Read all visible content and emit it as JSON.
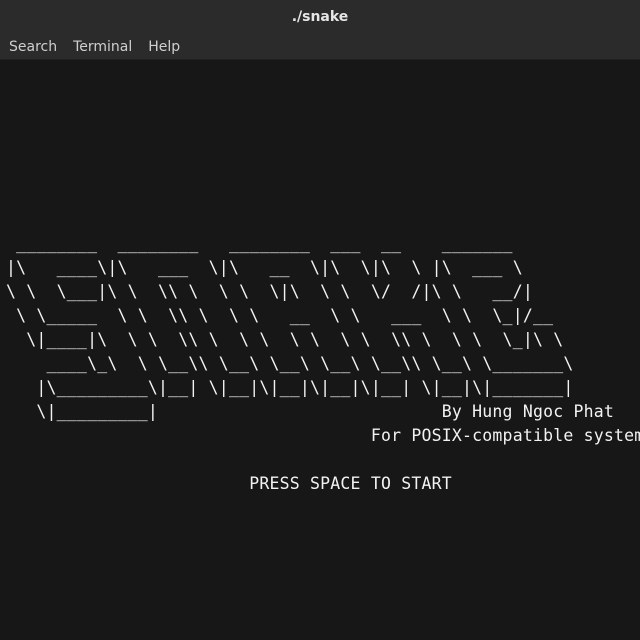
{
  "window": {
    "title": "./snake"
  },
  "menu": {
    "items": [
      "Search",
      "Terminal",
      "Help"
    ]
  },
  "terminal": {
    "lines": [
      " ________  ________   ________  ___  __    _______",
      "|\\   ____\\|\\   ___  \\|\\   __  \\|\\  \\|\\  \\ |\\  ___ \\",
      "\\ \\  \\___|\\ \\  \\\\ \\  \\ \\  \\|\\  \\ \\  \\/  /|\\ \\   __/|",
      " \\ \\_____  \\ \\  \\\\ \\  \\ \\   __  \\ \\   ___  \\ \\  \\_|/__",
      "  \\|____|\\  \\ \\  \\\\ \\  \\ \\  \\ \\  \\ \\  \\\\ \\  \\ \\  \\_|\\ \\",
      "    ____\\_\\  \\ \\__\\\\ \\__\\ \\__\\ \\__\\ \\__\\\\ \\__\\ \\_______\\",
      "   |\\_________\\|__| \\|__|\\|__|\\|__|\\|__| \\|__|\\|_______|",
      "   \\|_________|                            By Hung Ngoc Phat",
      "                                    For POSIX-compatible systems",
      "",
      "                        PRESS SPACE TO START"
    ]
  }
}
